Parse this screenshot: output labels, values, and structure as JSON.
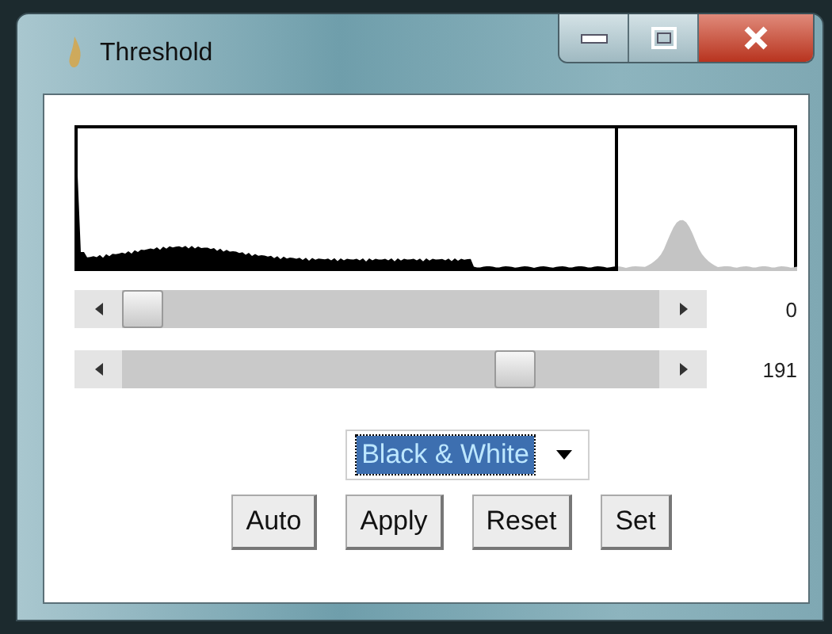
{
  "window": {
    "title": "Threshold"
  },
  "sliders": [
    {
      "level": 0,
      "reading": "0"
    },
    {
      "level": 0.75,
      "reading": "191"
    }
  ],
  "mode_dropdown": {
    "value": "Black & White"
  },
  "buttons": [
    "Auto",
    "Apply",
    "Reset",
    "Set"
  ]
}
